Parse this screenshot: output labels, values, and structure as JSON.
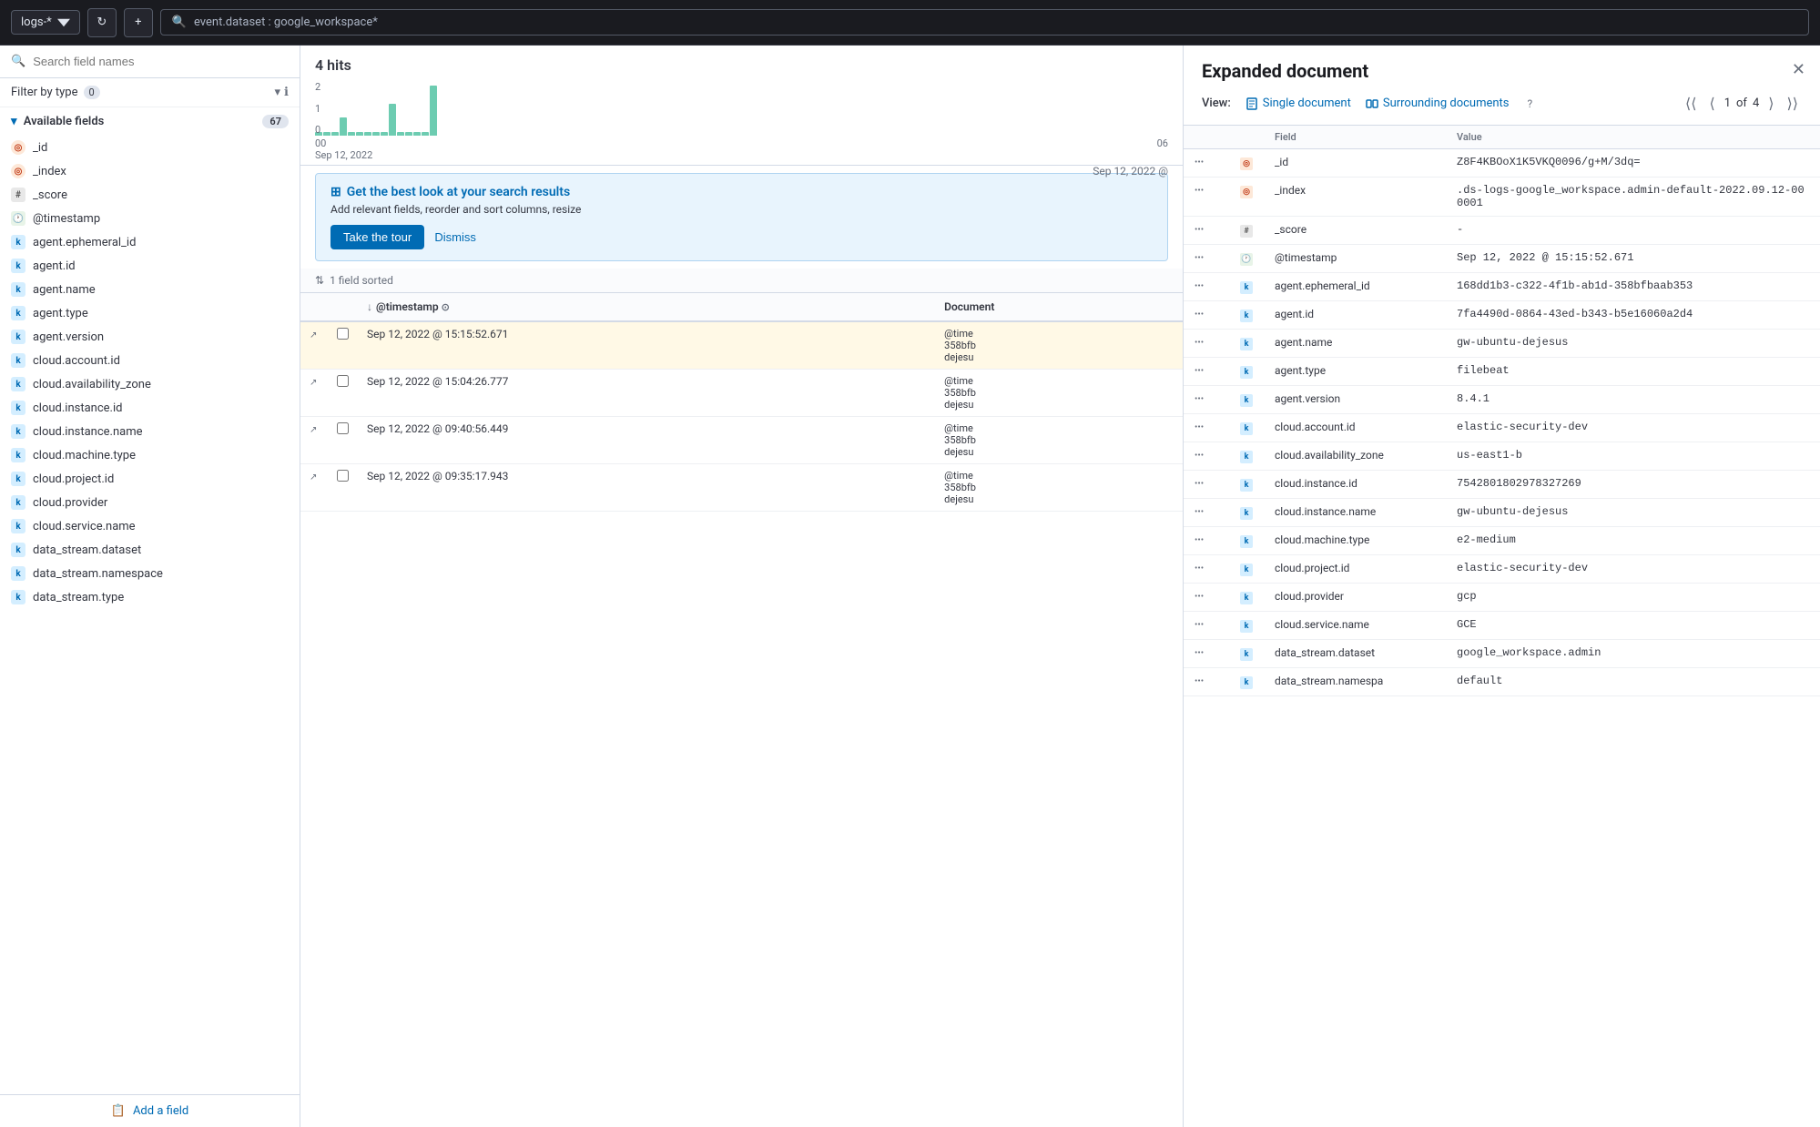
{
  "topbar": {
    "logs_label": "logs-*",
    "search_query": "event.dataset : google_workspace*",
    "cycle_icon": "↻",
    "add_icon": "+"
  },
  "sidebar": {
    "search_placeholder": "Search field names",
    "filter_label": "Filter by type",
    "filter_count": "0",
    "available_label": "Available fields",
    "field_count": "67",
    "collapse_icon": "←",
    "fields": [
      {
        "name": "_id",
        "type": "id"
      },
      {
        "name": "_index",
        "type": "id"
      },
      {
        "name": "_score",
        "type": "hash"
      },
      {
        "name": "@timestamp",
        "type": "ts"
      },
      {
        "name": "agent.ephemeral_id",
        "type": "k"
      },
      {
        "name": "agent.id",
        "type": "k"
      },
      {
        "name": "agent.name",
        "type": "k"
      },
      {
        "name": "agent.type",
        "type": "k"
      },
      {
        "name": "agent.version",
        "type": "k"
      },
      {
        "name": "cloud.account.id",
        "type": "k"
      },
      {
        "name": "cloud.availability_zone",
        "type": "k"
      },
      {
        "name": "cloud.instance.id",
        "type": "k"
      },
      {
        "name": "cloud.instance.name",
        "type": "k"
      },
      {
        "name": "cloud.machine.type",
        "type": "k"
      },
      {
        "name": "cloud.project.id",
        "type": "k"
      },
      {
        "name": "cloud.provider",
        "type": "k"
      },
      {
        "name": "cloud.service.name",
        "type": "k"
      },
      {
        "name": "data_stream.dataset",
        "type": "k"
      },
      {
        "name": "data_stream.namespace",
        "type": "k"
      },
      {
        "name": "data_stream.type",
        "type": "k"
      }
    ],
    "add_field_label": "Add a field"
  },
  "main": {
    "hits_count": "4 hits",
    "chart": {
      "y_labels": [
        "2",
        "1",
        "0"
      ],
      "x_labels": [
        "00\nSep 12, 2022",
        "06"
      ],
      "timestamp_label": "Sep 12, 2022 @"
    },
    "tour_banner": {
      "title": "Get the best look at your search results",
      "description": "Add relevant fields, reorder and sort columns, resize",
      "tour_btn": "Take the tour",
      "dismiss_btn": "Dismiss"
    },
    "sort_label": "1 field sorted",
    "table": {
      "cols": [
        "@timestamp",
        "Document"
      ],
      "rows": [
        {
          "timestamp": "Sep 12, 2022 @ 15:15:52.671",
          "doc": "@time\n358bfb\ndejesu",
          "highlight": true
        },
        {
          "timestamp": "Sep 12, 2022 @ 15:04:26.777",
          "doc": "@time\n358bfb\ndejesu",
          "highlight": false
        },
        {
          "timestamp": "Sep 12, 2022 @ 09:40:56.449",
          "doc": "@time\n358bfb\ndejesu",
          "highlight": false
        },
        {
          "timestamp": "Sep 12, 2022 @ 09:35:17.943",
          "doc": "@time\n358bfb\ndejesu",
          "highlight": false
        }
      ]
    }
  },
  "expanded": {
    "title": "Expanded document",
    "view_label": "View:",
    "single_doc_label": "Single document",
    "surrounding_label": "Surrounding documents",
    "nav_current": "1",
    "nav_total": "4",
    "nav_of": "of",
    "fields": [
      {
        "type": "id",
        "name": "_id",
        "value": "Z8F4KBOoX1K5VKQ0096/g+M/3dq="
      },
      {
        "type": "id",
        "name": "_index",
        "value": ".ds-logs-google_workspace.admin-default-2022.09.12-000001"
      },
      {
        "type": "hash",
        "name": "_score",
        "value": "-"
      },
      {
        "type": "ts",
        "name": "@timestamp",
        "value": "Sep 12, 2022 @ 15:15:52.671"
      },
      {
        "type": "k",
        "name": "agent.ephemeral_id",
        "value": "168dd1b3-c322-4f1b-ab1d-358bfbaab353"
      },
      {
        "type": "k",
        "name": "agent.id",
        "value": "7fa4490d-0864-43ed-b343-b5e16060a2d4"
      },
      {
        "type": "k",
        "name": "agent.name",
        "value": "gw-ubuntu-dejesus"
      },
      {
        "type": "k",
        "name": "agent.type",
        "value": "filebeat"
      },
      {
        "type": "k",
        "name": "agent.version",
        "value": "8.4.1"
      },
      {
        "type": "k",
        "name": "cloud.account.id",
        "value": "elastic-security-dev"
      },
      {
        "type": "k",
        "name": "cloud.availability_zone",
        "value": "us-east1-b"
      },
      {
        "type": "k",
        "name": "cloud.instance.id",
        "value": "7542801802978327269"
      },
      {
        "type": "k",
        "name": "cloud.instance.name",
        "value": "gw-ubuntu-dejesus"
      },
      {
        "type": "k",
        "name": "cloud.machine.type",
        "value": "e2-medium"
      },
      {
        "type": "k",
        "name": "cloud.project.id",
        "value": "elastic-security-dev"
      },
      {
        "type": "k",
        "name": "cloud.provider",
        "value": "gcp"
      },
      {
        "type": "k",
        "name": "cloud.service.name",
        "value": "GCE"
      },
      {
        "type": "k",
        "name": "data_stream.dataset",
        "value": "google_workspace.admin"
      },
      {
        "type": "k",
        "name": "data_stream.namespa",
        "value": "default"
      }
    ]
  }
}
